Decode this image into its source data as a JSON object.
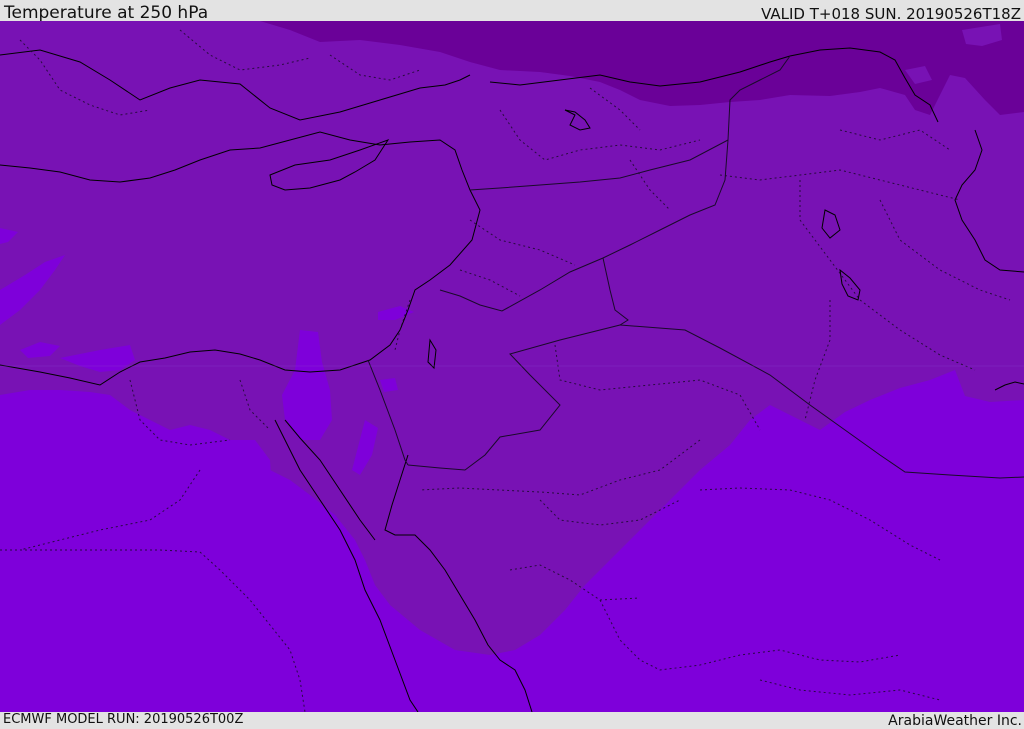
{
  "header": {
    "title": "Temperature at 250 hPa",
    "valid_time": "VALID T+018 SUN. 20190526T18Z"
  },
  "footer": {
    "model_run": "ECMWF MODEL RUN: 20190526T00Z",
    "credit": "ArabiaWeather Inc."
  },
  "map": {
    "colors": {
      "warm_band": "#7e00da",
      "mid_band": "#7812b4",
      "cold_band": "#6a0198",
      "coast_line": "#000000",
      "border_line": "#1a0a2a"
    }
  }
}
